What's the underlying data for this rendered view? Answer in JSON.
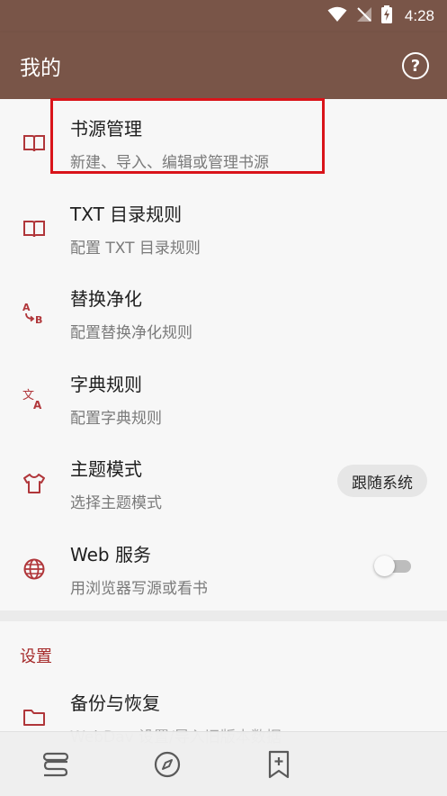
{
  "status_bar": {
    "time": "4:28"
  },
  "appbar": {
    "title": "我的",
    "help_icon": "help-circle-icon"
  },
  "items": [
    {
      "title": "书源管理",
      "subtitle": "新建、导入、编辑或管理书源",
      "icon": "book-open-icon"
    },
    {
      "title": "TXT 目录规则",
      "subtitle": "配置 TXT 目录规则",
      "icon": "book-open-icon"
    },
    {
      "title": "替换净化",
      "subtitle": "配置替换净化规则",
      "icon": "swap-ab-icon"
    },
    {
      "title": "字典规则",
      "subtitle": "配置字典规则",
      "icon": "translate-icon"
    },
    {
      "title": "主题模式",
      "subtitle": "选择主题模式",
      "icon": "shirt-icon",
      "value": "跟随系统"
    },
    {
      "title": "Web 服务",
      "subtitle": "用浏览器写源或看书",
      "icon": "globe-icon",
      "switch_on": false
    }
  ],
  "settings": {
    "section_title": "设置",
    "items": [
      {
        "title": "备份与恢复",
        "subtitle": "WebDav 设置/导入旧版本数据",
        "icon": "folder-icon"
      }
    ]
  },
  "bottom_nav": [
    {
      "icon": "bookshelf-icon"
    },
    {
      "icon": "compass-icon"
    },
    {
      "icon": "bookmark-add-icon"
    }
  ],
  "colors": {
    "primary": "#795548",
    "accent_icon": "#b0363a",
    "highlight_box": "#d9141a"
  }
}
